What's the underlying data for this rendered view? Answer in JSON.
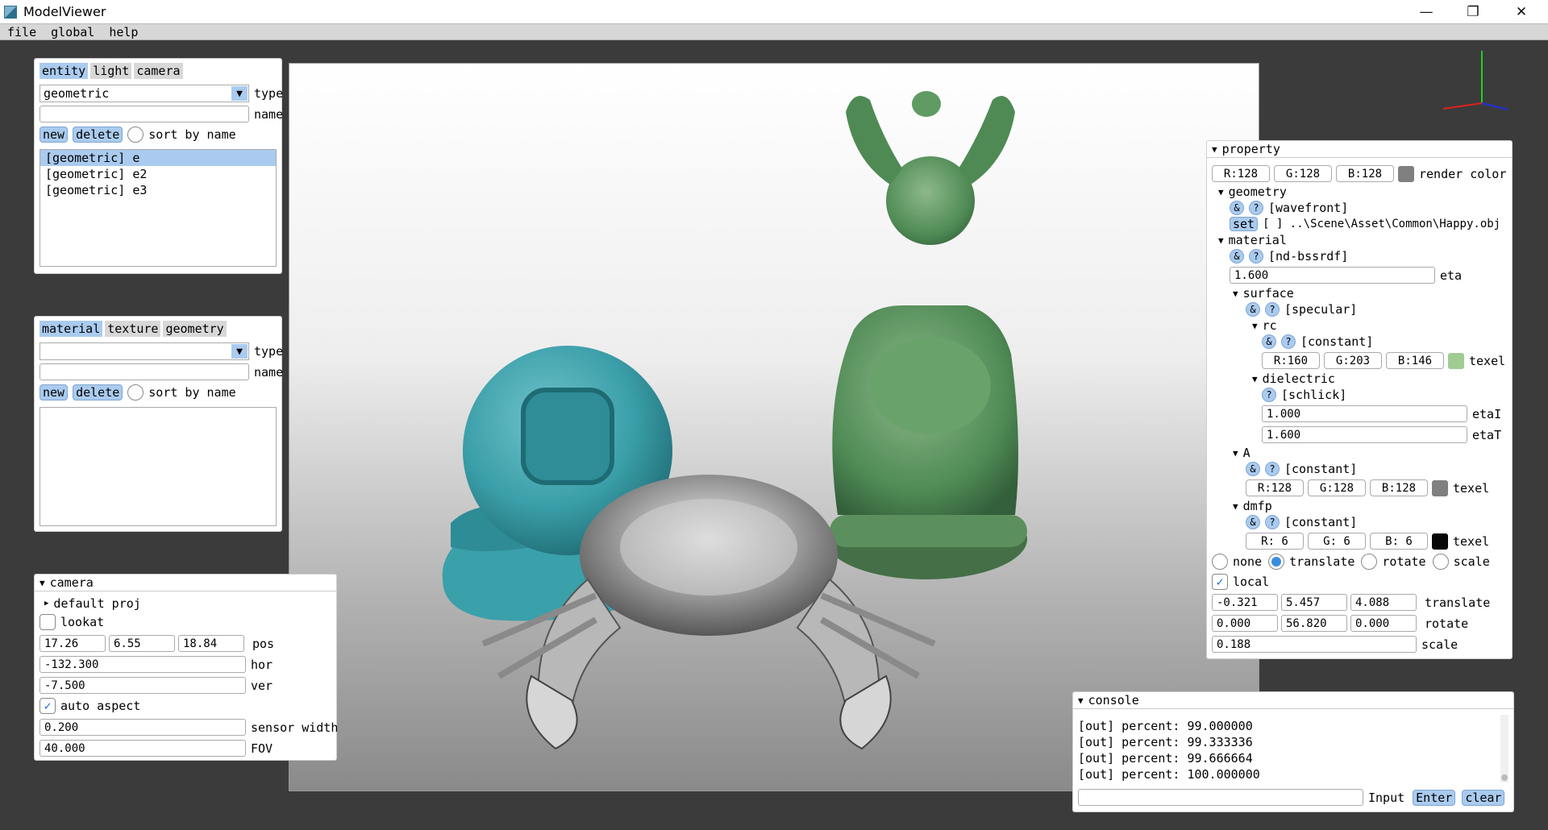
{
  "window": {
    "title": "ModelViewer",
    "minimize": "—",
    "restore": "❐",
    "close": "✕"
  },
  "menu": [
    "file",
    "global",
    "help"
  ],
  "entity_panel": {
    "tabs": [
      "entity",
      "light",
      "camera"
    ],
    "type_value": "geometric",
    "type_label": "type",
    "name_value": "",
    "name_label": "name",
    "new_label": "new",
    "delete_label": "delete",
    "sort_label": "sort by name",
    "items": [
      "[geometric] e",
      "[geometric] e2",
      "[geometric] e3"
    ],
    "selected_index": 0
  },
  "material_panel": {
    "tabs": [
      "material",
      "texture",
      "geometry"
    ],
    "type_value": "",
    "type_label": "type",
    "name_value": "",
    "name_label": "name",
    "new_label": "new",
    "delete_label": "delete",
    "sort_label": "sort by name"
  },
  "camera_panel": {
    "header": "camera",
    "default_proj": "default proj",
    "lookat_label": "lookat",
    "pos": [
      "17.26",
      "6.55",
      "18.84"
    ],
    "pos_label": "pos",
    "hor": "-132.300",
    "hor_label": "hor",
    "ver": "-7.500",
    "ver_label": "ver",
    "auto_aspect_label": "auto aspect",
    "sensor_width": "0.200",
    "sensor_width_label": "sensor width",
    "fov": "40.000",
    "fov_label": "FOV"
  },
  "property_panel": {
    "header": "property",
    "render_color": {
      "r": "R:128",
      "g": "G:128",
      "b": "B:128",
      "label": "render color",
      "color": "#808080"
    },
    "geometry": {
      "label": "geometry",
      "type": "[wavefront]",
      "set_label": "set",
      "path": "[ ] ..\\Scene\\Asset\\Common\\Happy.obj"
    },
    "material": {
      "label": "material",
      "type": "[nd-bssrdf]",
      "eta": "1.600",
      "eta_label": "eta"
    },
    "surface": {
      "label": "surface",
      "type": "[specular]"
    },
    "rc": {
      "label": "rc",
      "type": "[constant]",
      "r": "R:160",
      "g": "G:203",
      "b": "B:146",
      "texel": "texel",
      "color": "#a0cb92"
    },
    "dielectric": {
      "label": "dielectric",
      "type": "[schlick]",
      "etaI": "1.000",
      "etaI_label": "etaI",
      "etaT": "1.600",
      "etaT_label": "etaT"
    },
    "A": {
      "label": "A",
      "type": "[constant]",
      "r": "R:128",
      "g": "G:128",
      "b": "B:128",
      "texel": "texel",
      "color": "#808080"
    },
    "dmfp": {
      "label": "dmfp",
      "type": "[constant]",
      "r": "R:  6",
      "g": "G:  6",
      "b": "B:  6",
      "texel": "texel",
      "color": "#060606"
    },
    "modes": [
      "none",
      "translate",
      "rotate",
      "scale"
    ],
    "active_mode": "translate",
    "local_label": "local",
    "translate": [
      "-0.321",
      "5.457",
      "4.088"
    ],
    "translate_label": "translate",
    "rotate": [
      "0.000",
      "56.820",
      "0.000"
    ],
    "rotate_label": "rotate",
    "scale": "0.188",
    "scale_label": "scale"
  },
  "console": {
    "header": "console",
    "lines": [
      "[out] percent: 99.000000",
      "[out] percent: 99.333336",
      "[out] percent: 99.666664",
      "[out] percent: 100.000000"
    ],
    "input_value": "",
    "input_label": "Input",
    "enter_label": "Enter",
    "clear_label": "clear"
  },
  "symbols": {
    "amp": "&",
    "question": "?",
    "tri_down": "▼",
    "tri_right": "▶",
    "check": "✓"
  }
}
